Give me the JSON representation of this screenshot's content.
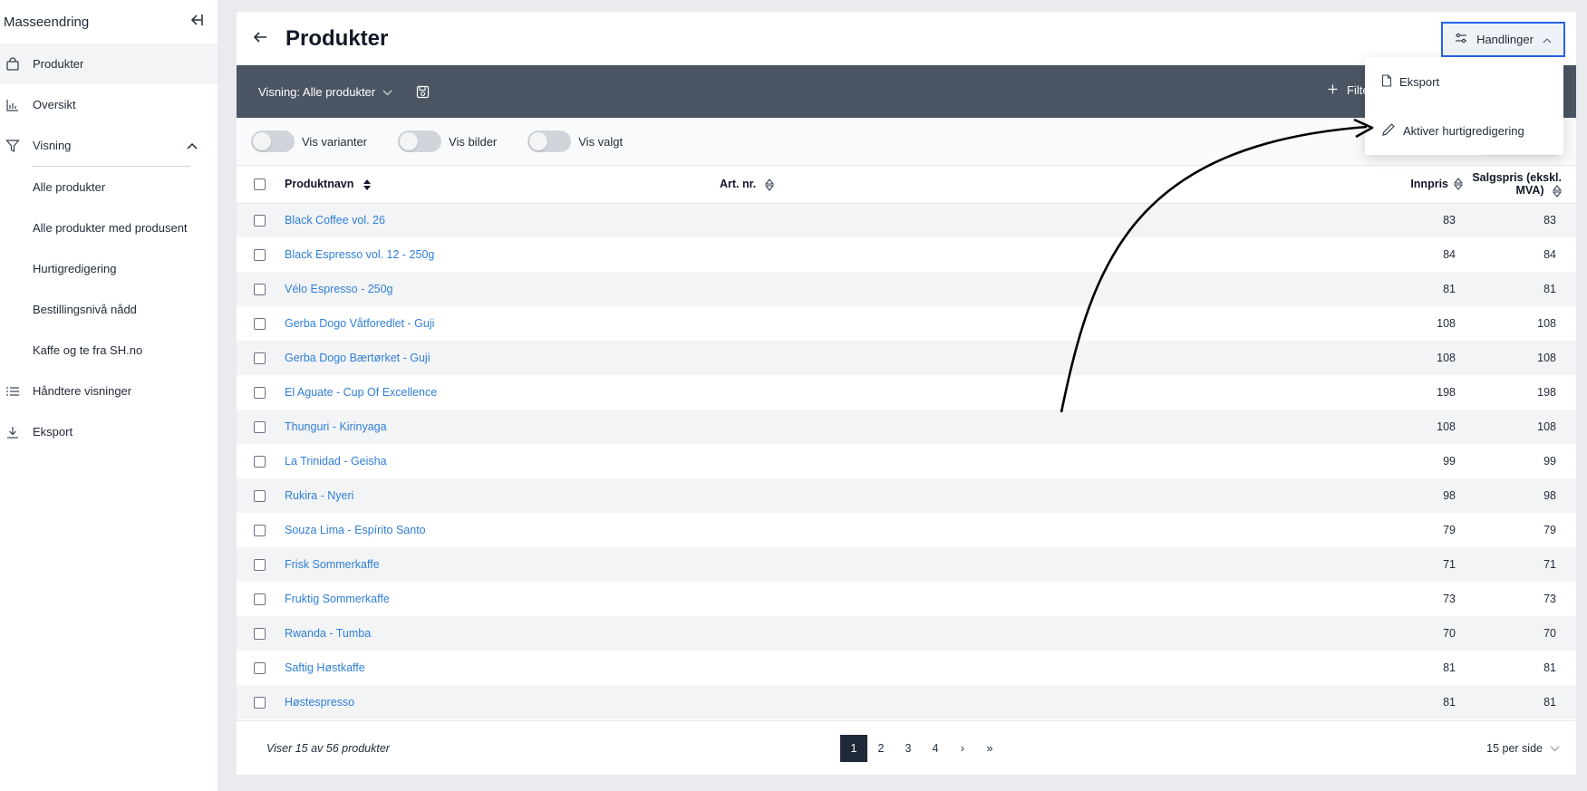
{
  "sidebar": {
    "title": "Masseendring",
    "items": [
      {
        "label": "Produkter",
        "icon": "shopping-bag-icon"
      },
      {
        "label": "Oversikt",
        "icon": "bar-chart-icon"
      },
      {
        "label": "Visning",
        "icon": "filter-icon"
      }
    ],
    "views": [
      "Alle produkter",
      "Alle produkter med produsent",
      "Hurtigredigering",
      "Bestillingsnivå nådd",
      "Kaffe og te fra SH.no"
    ],
    "manage_label": "Håndtere visninger",
    "export_label": "Eksport"
  },
  "header": {
    "title": "Produkter",
    "actions_label": "Handlinger"
  },
  "toolbar": {
    "view_label": "Visning: Alle produkter",
    "filter_label": "Filte"
  },
  "toggles": [
    "Vis varianter",
    "Vis bilder",
    "Vis valgt"
  ],
  "table": {
    "columns": [
      "Produktnavn",
      "Art. nr.",
      "Innpris",
      "Salgspris (ekskl. MVA)"
    ],
    "rows": [
      {
        "name": "Black Coffee vol. 26",
        "art": "",
        "in": "83",
        "sale": "83"
      },
      {
        "name": "Black Espresso vol. 12 - 250g",
        "art": "",
        "in": "84",
        "sale": "84"
      },
      {
        "name": "Vélo Espresso - 250g",
        "art": "",
        "in": "81",
        "sale": "81"
      },
      {
        "name": "Gerba Dogo Våtforedlet - Guji",
        "art": "",
        "in": "108",
        "sale": "108"
      },
      {
        "name": "Gerba Dogo Bærtørket - Guji",
        "art": "",
        "in": "108",
        "sale": "108"
      },
      {
        "name": "El Aguate - Cup Of Excellence",
        "art": "",
        "in": "198",
        "sale": "198"
      },
      {
        "name": "Thunguri - Kirinyaga",
        "art": "",
        "in": "108",
        "sale": "108"
      },
      {
        "name": "La Trinidad - Geisha",
        "art": "",
        "in": "99",
        "sale": "99"
      },
      {
        "name": "Rukira - Nyeri",
        "art": "",
        "in": "98",
        "sale": "98"
      },
      {
        "name": "Souza Lima - Espírito Santo",
        "art": "",
        "in": "79",
        "sale": "79"
      },
      {
        "name": "Frisk Sommerkaffe",
        "art": "",
        "in": "71",
        "sale": "71"
      },
      {
        "name": "Fruktig Sommerkaffe",
        "art": "",
        "in": "73",
        "sale": "73"
      },
      {
        "name": "Rwanda - Tumba",
        "art": "",
        "in": "70",
        "sale": "70"
      },
      {
        "name": "Saftig Høstkaffe",
        "art": "",
        "in": "81",
        "sale": "81"
      },
      {
        "name": "Høstespresso",
        "art": "",
        "in": "81",
        "sale": "81"
      }
    ]
  },
  "footer": {
    "showing": "Viser 15 av 56 produkter",
    "pages": [
      "1",
      "2",
      "3",
      "4",
      "›",
      "»"
    ],
    "current_page": "1",
    "per_page": "15 per side"
  },
  "dropdown": {
    "items": [
      {
        "label": "Eksport",
        "icon": "document-icon"
      },
      {
        "label": "Aktiver hurtigredigering",
        "icon": "pencil-icon"
      }
    ]
  },
  "colors": {
    "accent": "#2563eb",
    "link": "#2f7fd6",
    "toolbar": "#4b5563"
  }
}
